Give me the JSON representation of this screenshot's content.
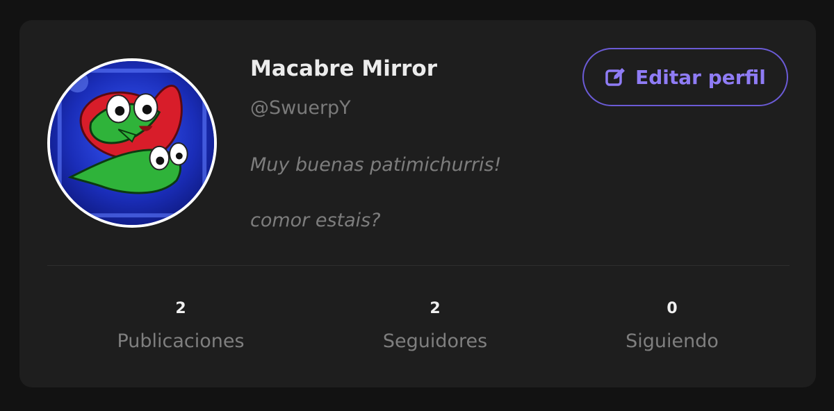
{
  "profile": {
    "display_name": "Macabre Mirror",
    "handle": "@SwuerpY",
    "bio_line_1": "Muy buenas patimichurris!",
    "bio_line_2": "comor estais?",
    "avatar_icon": "avatar-image"
  },
  "actions": {
    "edit_label": "Editar perfil",
    "edit_icon": "edit-icon"
  },
  "stats": [
    {
      "value": "2",
      "label": "Publicaciones"
    },
    {
      "value": "2",
      "label": "Seguidores"
    },
    {
      "value": "0",
      "label": "Siguiendo"
    }
  ],
  "colors": {
    "background": "#121212",
    "card": "#1e1e1e",
    "accent": "#8f7cf5",
    "accent_border": "#6b5bd6",
    "muted_text": "#7d7d7d"
  }
}
